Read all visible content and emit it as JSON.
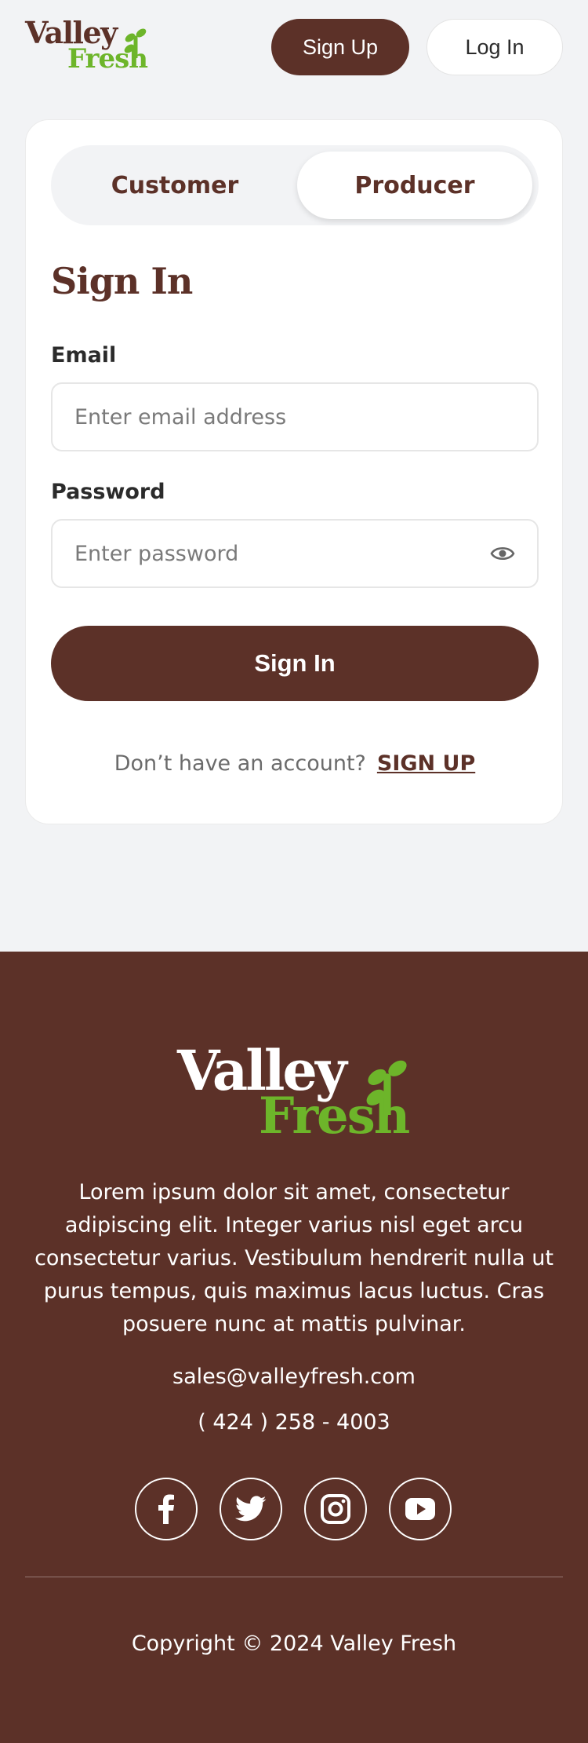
{
  "brand": {
    "name_line1": "Valley",
    "name_line2": "Fresh",
    "primary_color": "#5c3128",
    "accent_color": "#6db52a",
    "logo_icon": "sprout-icon"
  },
  "header": {
    "signup_label": "Sign Up",
    "login_label": "Log In"
  },
  "signin": {
    "tabs": [
      {
        "label": "Customer",
        "selected": false
      },
      {
        "label": "Producer",
        "selected": true
      }
    ],
    "title": "Sign In",
    "email_label": "Email",
    "email_placeholder": "Enter email address",
    "email_value": "",
    "password_label": "Password",
    "password_placeholder": "Enter password",
    "password_value": "",
    "password_toggle_icon": "eye-icon",
    "submit_label": "Sign In",
    "no_account_text": "Don’t have an account?",
    "signup_link": "SIGN UP"
  },
  "footer": {
    "description": "Lorem ipsum dolor sit amet, consectetur adipiscing elit. Integer varius nisl eget arcu consectetur varius. Vestibulum hendrerit nulla ut purus tempus, quis maximus lacus luctus. Cras posuere nunc at mattis pulvinar.",
    "email": "sales@valleyfresh.com",
    "phone": "( 424 ) 258 - 4003",
    "social_icons": [
      "facebook-icon",
      "twitter-icon",
      "instagram-icon",
      "youtube-icon"
    ],
    "copyright": "Copyright © 2024 Valley Fresh"
  }
}
